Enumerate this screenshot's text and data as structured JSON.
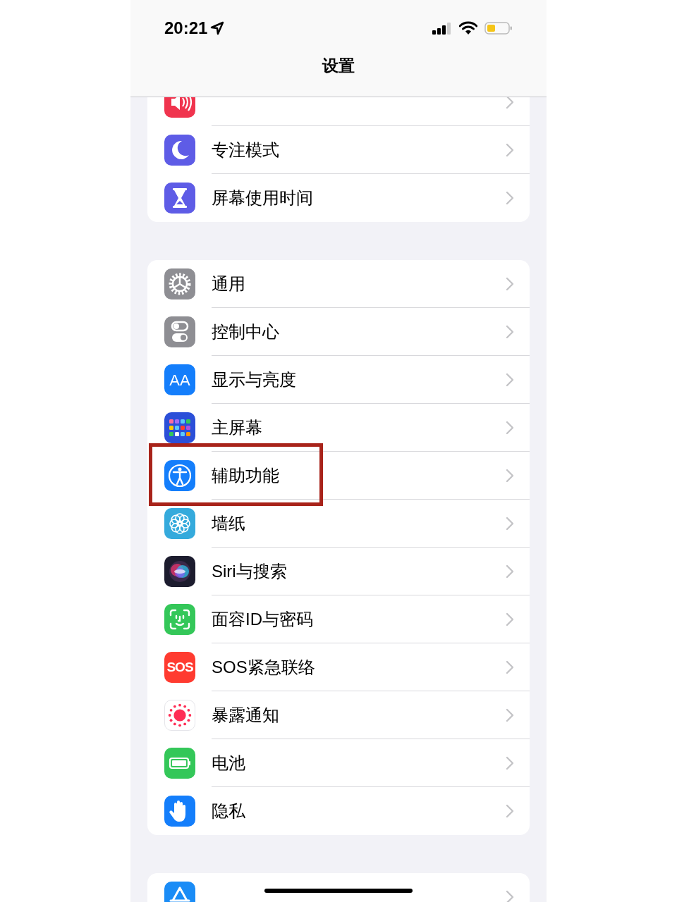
{
  "status_bar": {
    "time": "20:21"
  },
  "nav": {
    "title": "设置"
  },
  "groups": [
    {
      "items": [
        {
          "highlighted": false
        },
        {
          "label": "专注模式",
          "highlighted": false
        },
        {
          "label": "屏幕使用时间",
          "highlighted": false
        }
      ]
    },
    {
      "items": [
        {
          "label": "通用",
          "highlighted": false
        },
        {
          "label": "控制中心",
          "highlighted": false
        },
        {
          "label": "显示与亮度",
          "icon_text": "AA",
          "highlighted": false
        },
        {
          "label": "主屏幕",
          "highlighted": false
        },
        {
          "label": "辅助功能",
          "highlighted": true
        },
        {
          "label": "墙纸",
          "highlighted": false
        },
        {
          "label": "Siri与搜索",
          "highlighted": false
        },
        {
          "label": "面容ID与密码",
          "highlighted": false
        },
        {
          "label": "SOS紧急联络",
          "icon_text": "SOS",
          "highlighted": false
        },
        {
          "label": "暴露通知",
          "highlighted": false
        },
        {
          "label": "电池",
          "highlighted": false
        },
        {
          "label": "隐私",
          "highlighted": false
        }
      ]
    },
    {
      "items": [
        {
          "highlighted": false
        }
      ]
    }
  ]
}
